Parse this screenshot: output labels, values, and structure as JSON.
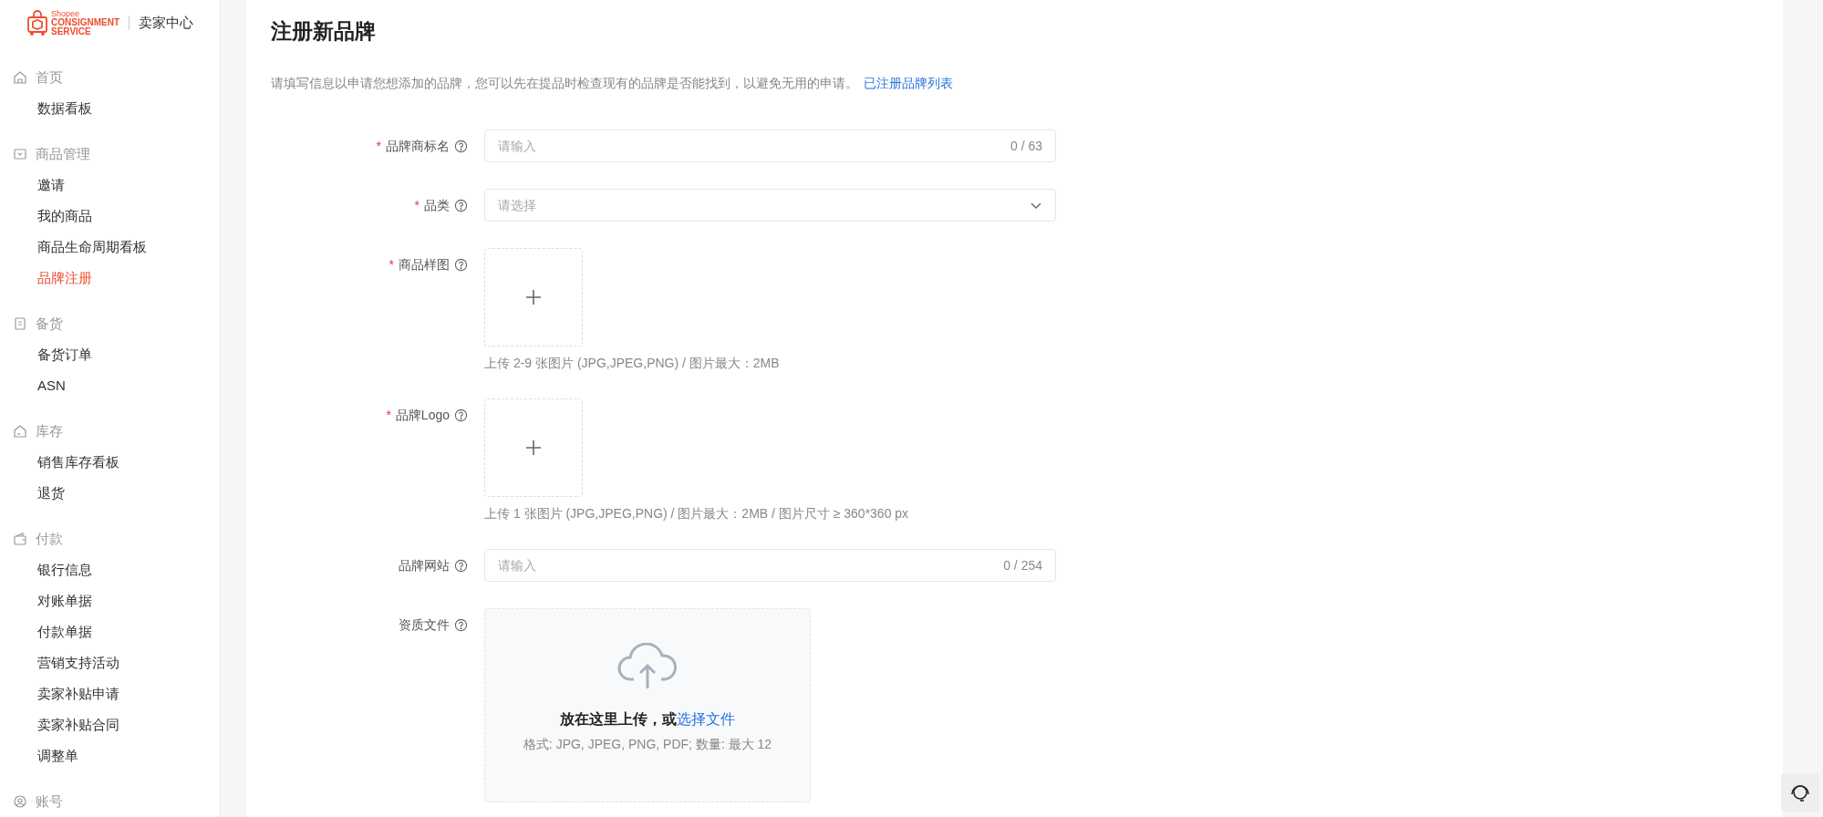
{
  "header": {
    "brand_small": "Shopee",
    "brand_line1": "CONSIGNMENT",
    "brand_line2": "SERVICE",
    "title": "卖家中心"
  },
  "sidebar": {
    "sections": [
      {
        "label": "首页",
        "items": [
          {
            "label": "数据看板",
            "selected": false
          }
        ]
      },
      {
        "label": "商品管理",
        "items": [
          {
            "label": "邀请",
            "selected": false
          },
          {
            "label": "我的商品",
            "selected": false
          },
          {
            "label": "商品生命周期看板",
            "selected": false
          },
          {
            "label": "品牌注册",
            "selected": true
          }
        ]
      },
      {
        "label": "备货",
        "items": [
          {
            "label": "备货订单",
            "selected": false
          },
          {
            "label": "ASN",
            "selected": false
          }
        ]
      },
      {
        "label": "库存",
        "items": [
          {
            "label": "销售库存看板",
            "selected": false
          },
          {
            "label": "退货",
            "selected": false
          }
        ]
      },
      {
        "label": "付款",
        "items": [
          {
            "label": "银行信息",
            "selected": false
          },
          {
            "label": "对账单据",
            "selected": false
          },
          {
            "label": "付款单据",
            "selected": false
          },
          {
            "label": "营销支持活动",
            "selected": false
          },
          {
            "label": "卖家补贴申请",
            "selected": false
          },
          {
            "label": "卖家补贴合同",
            "selected": false
          },
          {
            "label": "调整单",
            "selected": false
          }
        ]
      },
      {
        "label": "账号"
      }
    ]
  },
  "page": {
    "title": "注册新品牌",
    "description": "请填写信息以申请您想添加的品牌，您可以先在提品时检查现有的品牌是否能找到，以避免无用的申请。",
    "link": "已注册品牌列表"
  },
  "form": {
    "fields": [
      {
        "kind": "text",
        "label": "品牌商标名",
        "required_mark": "*",
        "placeholder": "请输入",
        "counter": "0 / 63"
      },
      {
        "kind": "select",
        "label": "品类",
        "required_mark": "*",
        "placeholder": "请选择"
      },
      {
        "kind": "image",
        "label": "商品样图",
        "required_mark": "*",
        "hint": "上传 2-9 张图片 (JPG,JPEG,PNG) / 图片最大：2MB"
      },
      {
        "kind": "image",
        "label": "品牌Logo",
        "required_mark": "*",
        "hint": "上传 1 张图片 (JPG,JPEG,PNG) / 图片最大：2MB / 图片尺寸 ≥ 360*360 px"
      },
      {
        "kind": "text",
        "label": "品牌网站",
        "placeholder": "请输入",
        "counter": "0 / 254"
      },
      {
        "kind": "file",
        "label": "资质文件",
        "drop_text": "放在这里上传，或",
        "drop_link": "选择文件",
        "formats": "格式: JPG, JPEG, PNG, PDF; 数量: 最大 12"
      }
    ]
  }
}
